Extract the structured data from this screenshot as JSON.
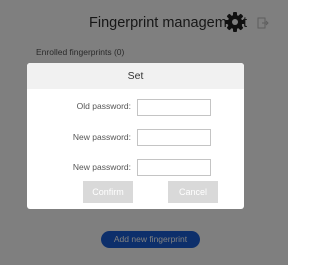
{
  "header": {
    "title": "Fingerprint management",
    "settings_icon": "gear-icon",
    "exit_icon": "exit-icon"
  },
  "main": {
    "enrolled_label": "Enrolled fingerprints (0)",
    "add_button_label": "Add new fingerprint"
  },
  "dialog": {
    "title": "Set",
    "fields": [
      {
        "label": "Old password:",
        "value": ""
      },
      {
        "label": "New password:",
        "value": ""
      },
      {
        "label": "New password:",
        "value": ""
      }
    ],
    "confirm_label": "Confirm",
    "cancel_label": "Cancel"
  },
  "colors": {
    "accent": "#1a5fd6",
    "disabled_button": "#d9d9d9",
    "dialog_title_bg": "#f1f1f1"
  }
}
